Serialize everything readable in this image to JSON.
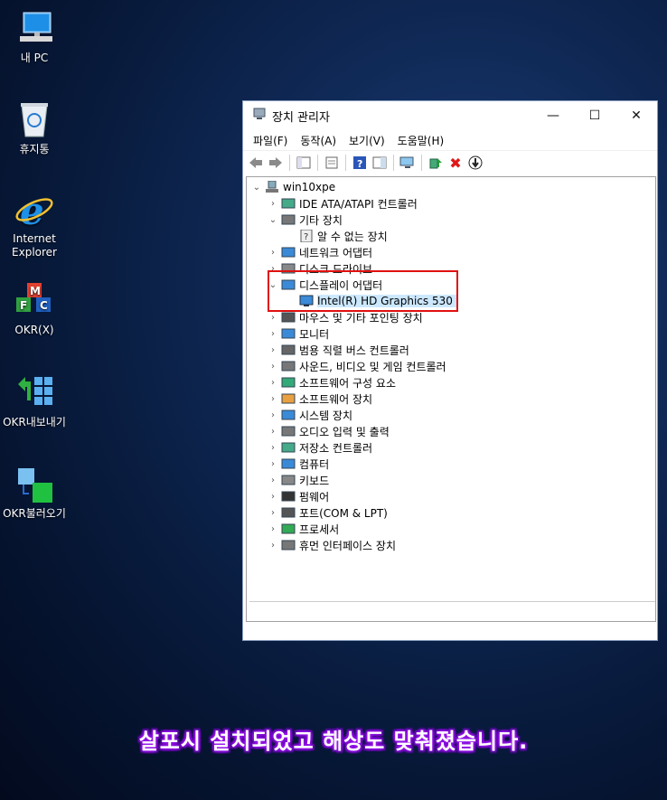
{
  "desktop": {
    "icons": [
      {
        "label": "내 PC",
        "icon": "computer-icon"
      },
      {
        "label": "휴지통",
        "icon": "recycle-bin-icon"
      },
      {
        "label": "Internet Explorer",
        "icon": "internet-explorer-icon"
      },
      {
        "label": "OKR(X)",
        "icon": "okr-icon"
      },
      {
        "label": "OKR내보내기",
        "icon": "okr-export-icon"
      },
      {
        "label": "OKR불러오기",
        "icon": "okr-import-icon"
      }
    ]
  },
  "window": {
    "title": "장치 관리자",
    "buttons": {
      "minimize": "—",
      "maximize": "☐",
      "close": "✕"
    },
    "menu": [
      "파일(F)",
      "동작(A)",
      "보기(V)",
      "도움말(H)"
    ],
    "tree": {
      "root": "win10xpe",
      "items": [
        {
          "label": "IDE ATA/ATAPI 컨트롤러",
          "expanded": false
        },
        {
          "label": "기타 장치",
          "expanded": true,
          "children": [
            "알 수 없는 장치"
          ]
        },
        {
          "label": "네트워크 어댑터",
          "expanded": false
        },
        {
          "label": "디스크 드라이브",
          "expanded": false
        },
        {
          "label": "디스플레이 어댑터",
          "expanded": true,
          "children": [
            "Intel(R) HD Graphics 530"
          ]
        },
        {
          "label": "마우스 및 기타 포인팅 장치",
          "expanded": false
        },
        {
          "label": "모니터",
          "expanded": false
        },
        {
          "label": "범용 직렬 버스 컨트롤러",
          "expanded": false
        },
        {
          "label": "사운드, 비디오 및 게임 컨트롤러",
          "expanded": false
        },
        {
          "label": "소프트웨어 구성 요소",
          "expanded": false
        },
        {
          "label": "소프트웨어 장치",
          "expanded": false
        },
        {
          "label": "시스템 장치",
          "expanded": false
        },
        {
          "label": "오디오 입력 및 출력",
          "expanded": false
        },
        {
          "label": "저장소 컨트롤러",
          "expanded": false
        },
        {
          "label": "컴퓨터",
          "expanded": false
        },
        {
          "label": "키보드",
          "expanded": false
        },
        {
          "label": "펌웨어",
          "expanded": false
        },
        {
          "label": "포트(COM & LPT)",
          "expanded": false
        },
        {
          "label": "프로세서",
          "expanded": false
        },
        {
          "label": "휴먼 인터페이스 장치",
          "expanded": false
        }
      ]
    }
  },
  "caption": "살포시 설치되었고 해상도 맞춰졌습니다.",
  "colors": {
    "highlight_box": "#e01010",
    "selection": "#cce8ff",
    "caption_glow": "#a020f0"
  }
}
